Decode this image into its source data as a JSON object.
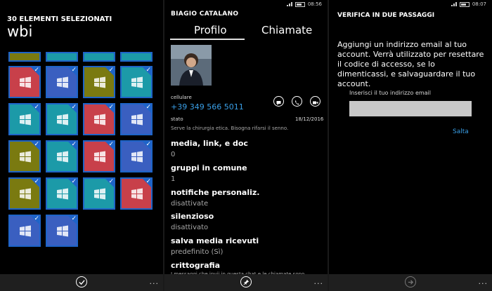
{
  "panel1": {
    "title": "30 ELEMENTI SELEZIONATI",
    "app_name": "wbi",
    "tile_colors": {
      "blue": "#3a5fc0",
      "red": "#c8404a",
      "olive": "#7a7a10",
      "teal": "#1c9aa8"
    },
    "tiles": [
      "olive",
      "teal",
      "teal",
      "teal",
      "red",
      "blue",
      "olive",
      "teal",
      "teal",
      "teal",
      "red",
      "blue",
      "olive",
      "teal",
      "red",
      "blue",
      "olive",
      "teal",
      "teal",
      "red",
      "blue",
      "blue"
    ],
    "appbar_more": "..."
  },
  "panel2": {
    "status_time": "08:56",
    "contact_name": "BIAGIO CATALANO",
    "tabs": [
      "Profilo",
      "Chiamate"
    ],
    "phone_label": "cellulare",
    "phone_number": "+39 349 566 5011",
    "status_label": "stato",
    "status_date": "18/12/2016",
    "status_text": "Serve la chirurgia etica. Bisogna rifarsi il senno.",
    "fields": [
      {
        "label": "media, link, e doc",
        "value": "0"
      },
      {
        "label": "gruppi in comune",
        "value": "1"
      },
      {
        "label": "notifiche personaliz.",
        "value": "disattivate"
      },
      {
        "label": "silenzioso",
        "value": "disattivato"
      },
      {
        "label": "salva media ricevuti",
        "value": "predefinito (Sì)"
      },
      {
        "label": "crittografia",
        "value": "I messaggi che invii in questa chat e le chiamate sono"
      }
    ],
    "appbar_more": "..."
  },
  "panel3": {
    "status_time": "08:07",
    "title": "VERIFICA IN DUE PASSAGGI",
    "body": "Aggiungi un indirizzo email al tuo account. Verrà utilizzato per resettare il codice di accesso, se lo dimenticassi, e salvaguardare il tuo account.",
    "email_label": "Inserisci il tuo indirizzo email",
    "email_value": "",
    "skip": "Salta",
    "appbar_more": "..."
  }
}
